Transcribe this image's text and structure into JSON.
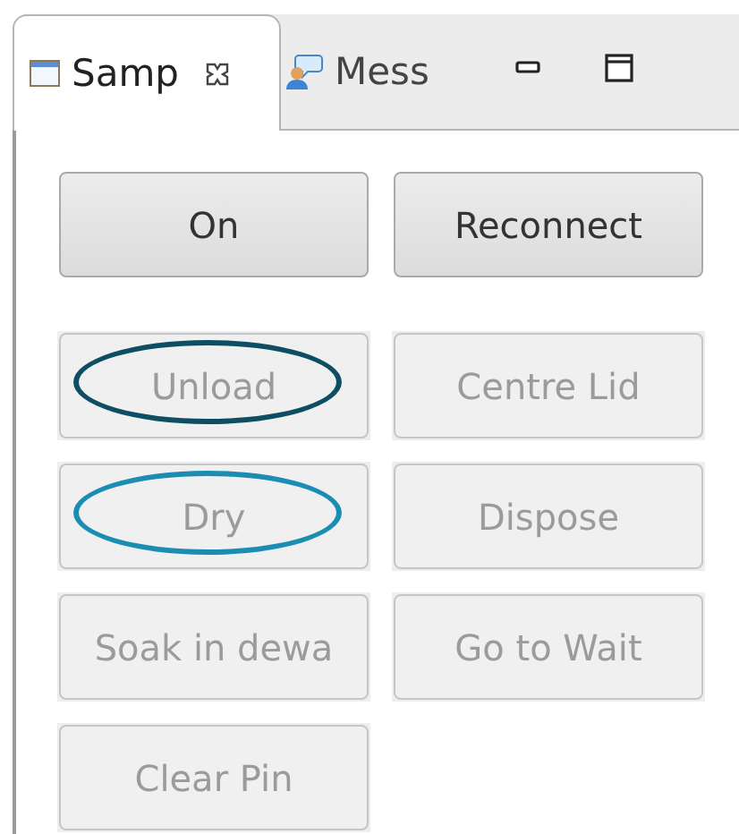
{
  "tabs": [
    {
      "label": "Samp",
      "selected": true,
      "closable": true,
      "kind": "window"
    },
    {
      "label": "Mess",
      "selected": false,
      "closable": false,
      "kind": "chat"
    }
  ],
  "buttons": [
    {
      "label": "On",
      "disabled": false
    },
    {
      "label": "Reconnect",
      "disabled": false
    },
    {
      "label": "Unload",
      "disabled": true,
      "color": "#0d4e63"
    },
    {
      "label": "Centre Lid",
      "disabled": true
    },
    {
      "label": "Dry",
      "disabled": true,
      "color": "#1b8db3"
    },
    {
      "label": "Dispose",
      "disabled": true
    },
    {
      "label": "Soak in dewa",
      "disabled": true
    },
    {
      "label": "Go to Wait",
      "disabled": true
    },
    {
      "label": "Clear Pin",
      "disabled": true
    }
  ]
}
